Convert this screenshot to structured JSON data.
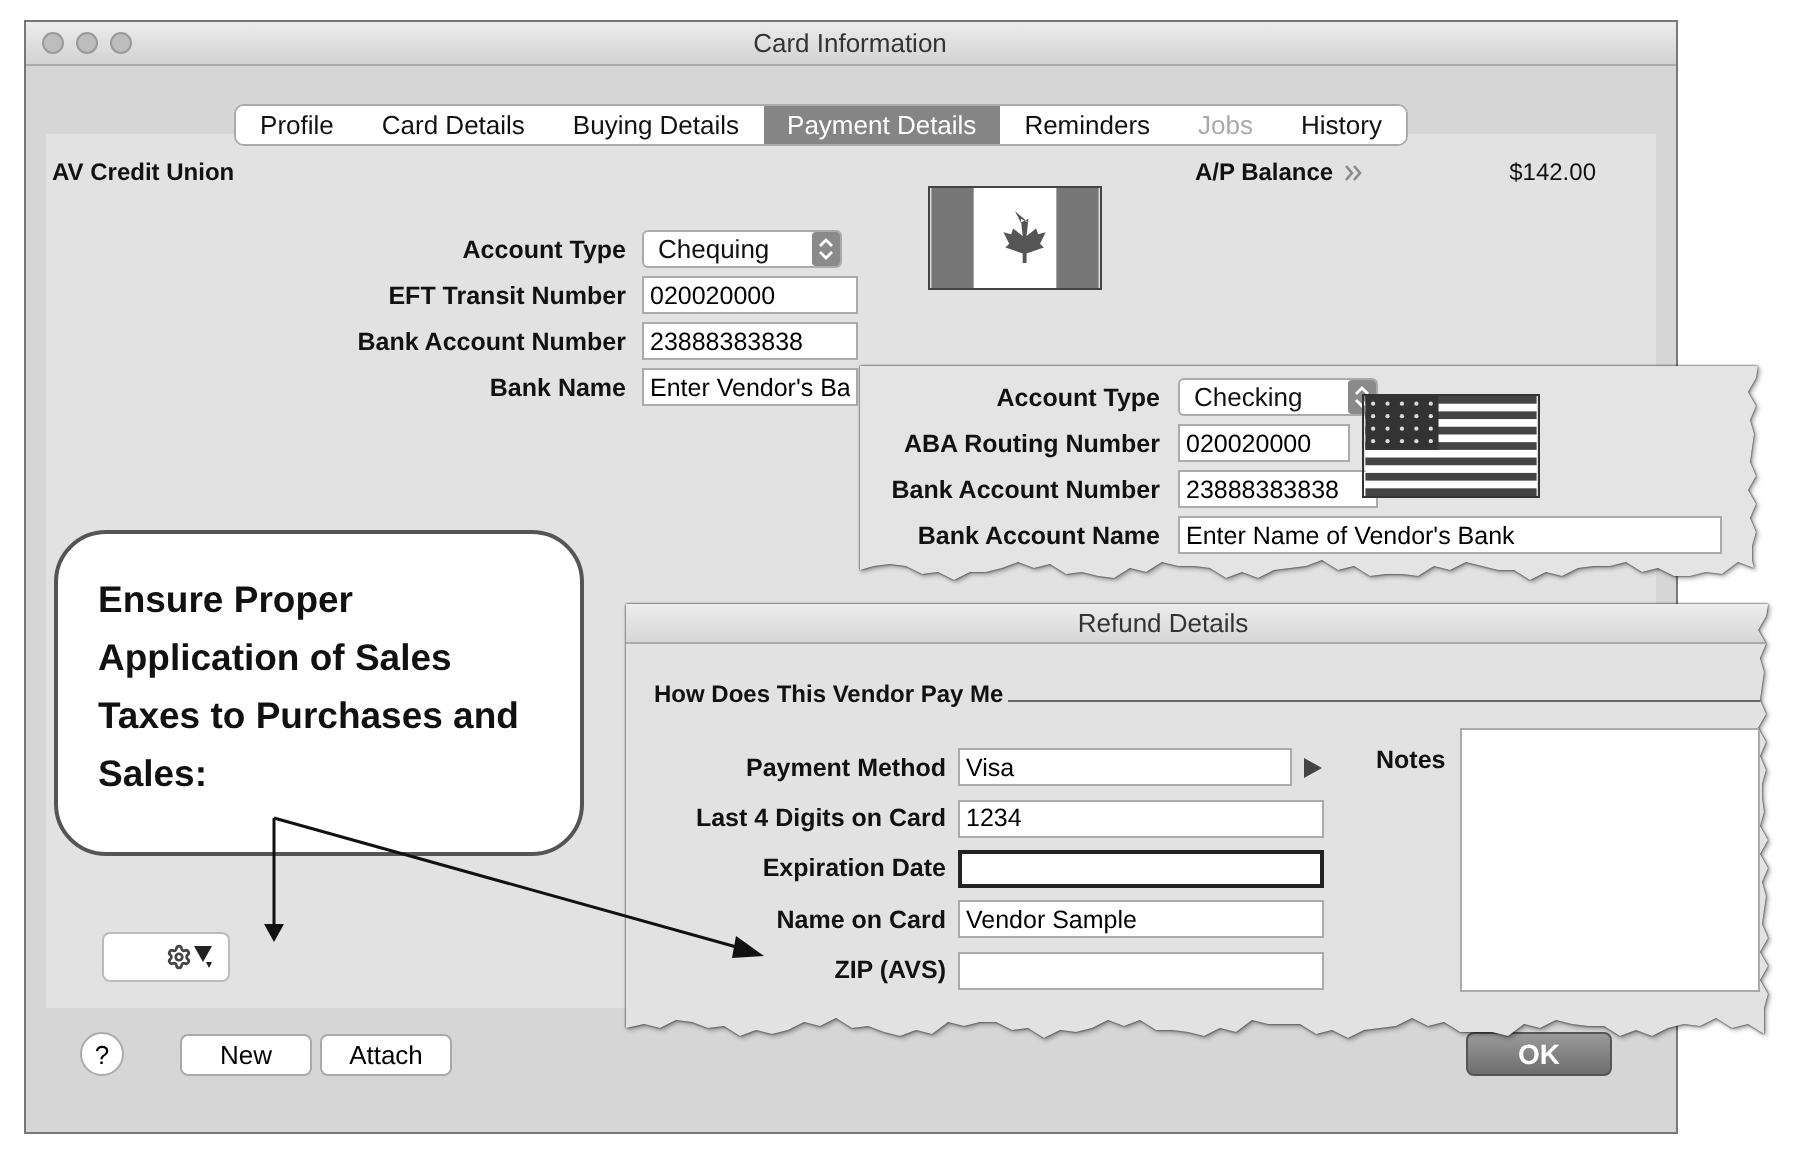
{
  "window": {
    "title": "Card Information"
  },
  "tabs": [
    {
      "label": "Profile",
      "selected": false,
      "disabled": false
    },
    {
      "label": "Card Details",
      "selected": false,
      "disabled": false
    },
    {
      "label": "Buying Details",
      "selected": false,
      "disabled": false
    },
    {
      "label": "Payment Details",
      "selected": true,
      "disabled": false
    },
    {
      "label": "Reminders",
      "selected": false,
      "disabled": false
    },
    {
      "label": "Jobs",
      "selected": false,
      "disabled": true
    },
    {
      "label": "History",
      "selected": false,
      "disabled": false
    }
  ],
  "header": {
    "card_name": "AV Credit Union",
    "balance_label": "A/P Balance",
    "balance": "$142.00"
  },
  "canada_bank": {
    "fields": [
      {
        "label": "Account Type",
        "value": "Chequing",
        "kind": "select"
      },
      {
        "label": "EFT Transit Number",
        "value": "020020000",
        "kind": "text"
      },
      {
        "label": "Bank Account Number",
        "value": "23888383838",
        "kind": "text"
      },
      {
        "label": "Bank Name",
        "value": "Enter Vendor's Ba",
        "kind": "text"
      }
    ]
  },
  "us_bank": {
    "fields": [
      {
        "label": "Account Type",
        "value": "Checking",
        "kind": "select"
      },
      {
        "label": "ABA Routing Number",
        "value": "020020000",
        "kind": "text"
      },
      {
        "label": "Bank Account Number",
        "value": "23888383838",
        "kind": "text"
      },
      {
        "label": "Bank Account Name",
        "value": "Enter Name of Vendor's Bank",
        "kind": "wide"
      }
    ]
  },
  "refund_details": {
    "title": "Refund Details",
    "section": "How Does This Vendor Pay Me",
    "fields": [
      {
        "label": "Payment Method",
        "value": "Visa",
        "kind": "menu",
        "focused": false
      },
      {
        "label": "Last 4 Digits on Card",
        "value": "1234",
        "kind": "text",
        "focused": false
      },
      {
        "label": "Expiration Date",
        "kind": "text",
        "focused": true
      },
      {
        "label": "Name on Card",
        "value": "Vendor Sample",
        "kind": "text",
        "focused": false
      },
      {
        "label": "ZIP (AVS)",
        "kind": "text",
        "focused": false
      }
    ],
    "notes_label": "Notes"
  },
  "callout": {
    "text": "Ensure Proper Application of Sales Taxes to Purchases and Sales:"
  },
  "buttons": {
    "help": "?",
    "new": "New",
    "attach": "Attach",
    "ok": "OK"
  }
}
